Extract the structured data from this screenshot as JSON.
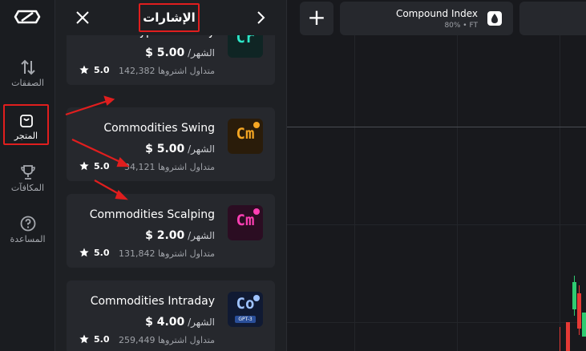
{
  "rail": {
    "items": [
      {
        "label": "الصفقات",
        "icon": "swap-arrows-icon"
      },
      {
        "label": "المتجر",
        "icon": "store-bag-icon"
      },
      {
        "label": "المكافآت",
        "icon": "trophy-icon"
      },
      {
        "label": "المساعدة",
        "icon": "help-icon"
      }
    ],
    "active_item": "المتجر"
  },
  "panel": {
    "title": "الإشارات",
    "cards": [
      {
        "name": "Crypto Intraday",
        "price": "$ 5.00",
        "period": "/الشهر",
        "subscribers": "142,382 متداول اشتروها",
        "rating": "5.0",
        "thumb_text": "Cr",
        "thumb_color": "#2ee6c8",
        "dot_color": "#2ee6c8"
      },
      {
        "name": "Commodities Swing",
        "price": "$ 5.00",
        "period": "/الشهر",
        "subscribers": "34,121 متداول اشتروها",
        "rating": "5.0",
        "thumb_text": "Cm",
        "thumb_color": "#f5a623",
        "dot_color": "#f5a623"
      },
      {
        "name": "Commodities Scalping",
        "price": "$ 2.00",
        "period": "/الشهر",
        "subscribers": "131,842 متداول اشتروها",
        "rating": "5.0",
        "thumb_text": "Cm",
        "thumb_color": "#ff3fb4",
        "dot_color": "#ff3fb4"
      },
      {
        "name": "Commodities Intraday",
        "price": "$ 4.00",
        "period": "/الشهر",
        "subscribers": "259,449 متداول اشتروها",
        "rating": "5.0",
        "thumb_text": "Co",
        "thumb_color": "#9fc3ff",
        "dot_color": "#9fc3ff",
        "badge": "GPT-3"
      }
    ]
  },
  "chart_header": {
    "add_label": "+",
    "asset_name": "Compound Index",
    "asset_meta": "80% • FT",
    "asset_icon": "drop-icon"
  },
  "colors": {
    "highlight_red": "#e01e1e",
    "up_green": "#2ecc71",
    "down_red": "#e53935"
  }
}
